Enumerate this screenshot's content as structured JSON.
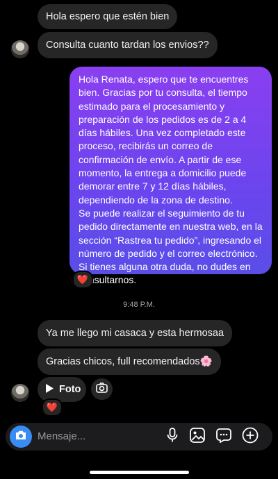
{
  "messages_in_top": [
    {
      "text": "Hola espero que estén bien"
    },
    {
      "text": "Consulta cuanto tardan los envios??"
    }
  ],
  "outgoing": {
    "paragraphs": [
      "Hola Renata, espero que te encuentres bien. Gracias por tu consulta, el tiempo estimado para el procesamiento y preparación de los pedidos es de 2 a 4 días hábiles. Una vez completado este proceso, recibirás un correo de confirmación de envío. A partir de ese momento, la entrega a domicilio puede demorar entre 7 y 12 días hábiles, dependiendo de la zona de destino.",
      "Se puede realizar el seguimiento de tu pedido directamente en nuestra web, en la sección “Rastrea tu pedido”, ingresando el número de pedido y el correo electrónico.",
      "Si tienes alguna otra duda, no dudes en consultarnos."
    ],
    "reaction": "❤️"
  },
  "timestamp": "9:48 P.M.",
  "messages_in_bottom": [
    {
      "text": "Ya me llego mi casaca y esta hermosaa"
    },
    {
      "text": "Gracias chicos, full recomendados🌸"
    }
  ],
  "photo_message": {
    "label": "Foto",
    "reaction": "❤️"
  },
  "composer": {
    "placeholder": "Mensaje..."
  },
  "colors": {
    "accent": "#3a8cf5",
    "bubble_in": "#262626",
    "gradient_top": "#8a3ff0",
    "gradient_bottom": "#5a4ee8"
  },
  "icons": [
    "camera-icon",
    "microphone-icon",
    "gallery-icon",
    "sticker-icon",
    "plus-icon",
    "play-icon",
    "heart-icon"
  ]
}
